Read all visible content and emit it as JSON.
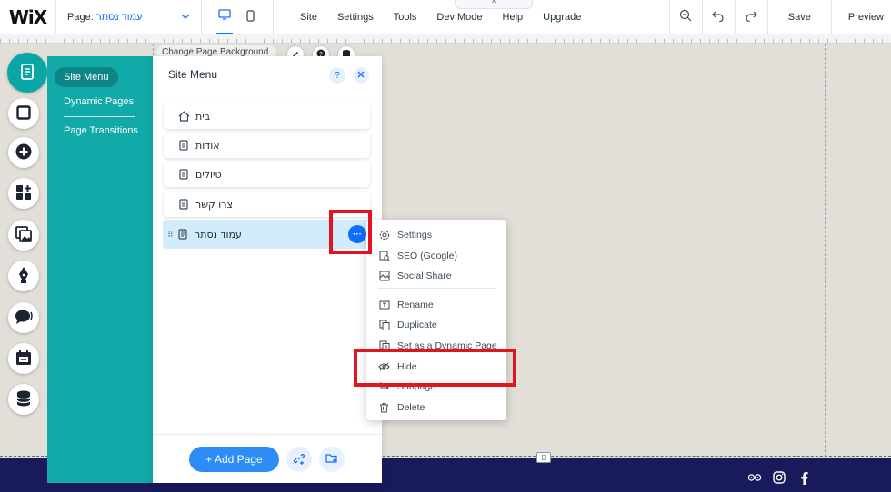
{
  "topbar": {
    "logo": "WiX",
    "page_label": "Page:",
    "page_value": "עמוד נסתר",
    "menus": [
      "Site",
      "Settings",
      "Tools",
      "Dev Mode",
      "Help",
      "Upgrade"
    ],
    "save": "Save",
    "preview": "Preview",
    "collapse_glyph": "^"
  },
  "stage": {
    "change_bg_label": "Change Page Background"
  },
  "teal_panel": {
    "tabs": [
      "Site Menu",
      "Dynamic Pages",
      "Page Transitions"
    ]
  },
  "site_menu": {
    "title": "Site Menu",
    "help_glyph": "?",
    "pages": [
      {
        "label": "בית",
        "icon": "home-icon"
      },
      {
        "label": "אודות",
        "icon": "page-icon"
      },
      {
        "label": "טיולים",
        "icon": "page-icon"
      },
      {
        "label": "צרו קשר",
        "icon": "page-icon"
      },
      {
        "label": "עמוד נסתר",
        "icon": "page-icon",
        "selected": true
      }
    ],
    "more_glyph": "···",
    "add_page": "+ Add Page"
  },
  "context_menu": {
    "items": [
      "Settings",
      "SEO (Google)",
      "Social Share",
      "Rename",
      "Duplicate",
      "Set as a Dynamic Page",
      "Hide",
      "Subpage",
      "Delete"
    ]
  },
  "footer": {
    "handle_glyph": "▯"
  },
  "colors": {
    "accent": "#116dff",
    "teal": "#12a9a9",
    "highlight": "#e3131f",
    "footer": "#181a5c"
  }
}
